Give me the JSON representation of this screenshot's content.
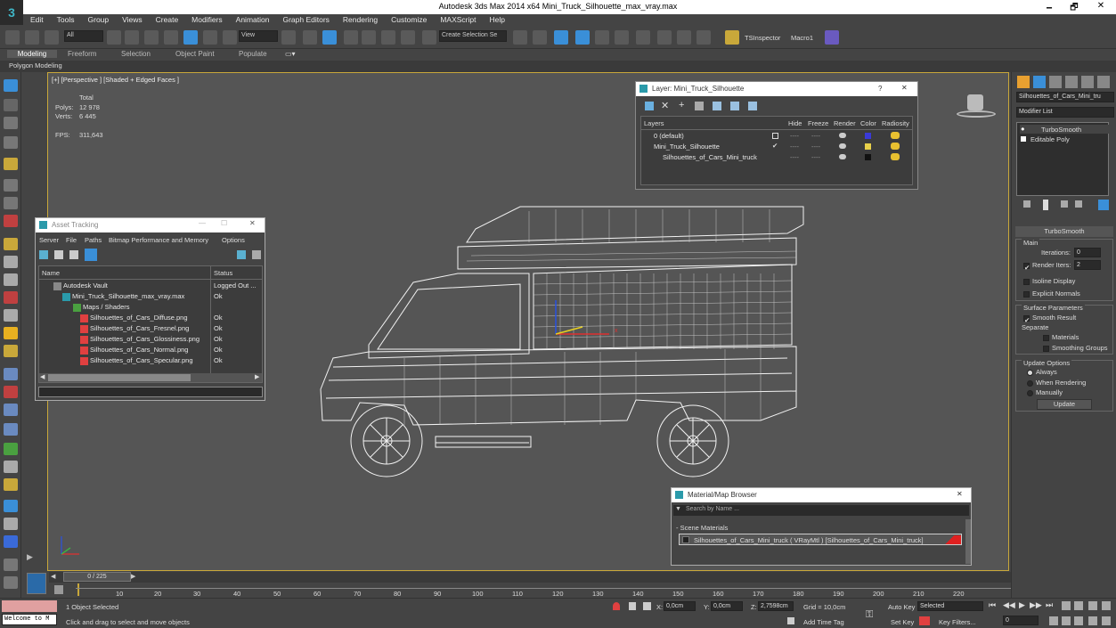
{
  "window": {
    "title": "Autodesk 3ds Max  2014 x64      Mini_Truck_Silhouette_max_vray.max",
    "minimize": "🗕",
    "maximize": "🗗",
    "close": "✕"
  },
  "menu": [
    "Edit",
    "Tools",
    "Group",
    "Views",
    "Create",
    "Modifiers",
    "Animation",
    "Graph Editors",
    "Rendering",
    "Customize",
    "MAXScript",
    "Help"
  ],
  "toolbar": {
    "selection_filter": "All",
    "ref_coord": "View",
    "named_selection_placeholder": "Create Selection Se",
    "tsinspector": "TSInspector",
    "macro": "Macro1"
  },
  "ribbon": {
    "tabs": [
      "Modeling",
      "Freeform",
      "Selection",
      "Object Paint",
      "Populate"
    ],
    "sub": "Polygon Modeling"
  },
  "viewport": {
    "label": "[+] [Perspective ] [Shaded + Edged Faces ]",
    "stats_total": "Total",
    "polys_label": "Polys:",
    "polys_value": "12 978",
    "verts_label": "Verts:",
    "verts_value": "6 445",
    "fps_label": "FPS:",
    "fps_value": "311,643",
    "axis_x": "x"
  },
  "layer_window": {
    "title": "Layer: Mini_Truck_Silhouette",
    "help": "?",
    "close": "✕",
    "columns": [
      "Layers",
      "Hide",
      "Freeze",
      "Render",
      "Color",
      "Radiosity"
    ],
    "rows": [
      {
        "name": "0 (default)",
        "color": "#3a3ad8"
      },
      {
        "name": "Mini_Truck_Silhouette",
        "color": "#e8d04a"
      },
      {
        "name": "Silhouettes_of_Cars_Mini_truck",
        "color": "#111111"
      }
    ]
  },
  "asset_tracking": {
    "title": "Asset Tracking",
    "menu": [
      "Server",
      "File",
      "Paths",
      "Bitmap Performance and Memory",
      "Options"
    ],
    "col_name": "Name",
    "col_status": "Status",
    "rows": [
      {
        "name": "Autodesk Vault",
        "status": "Logged Out ..."
      },
      {
        "name": "Mini_Truck_Silhouette_max_vray.max",
        "status": "Ok"
      },
      {
        "name": "Maps / Shaders",
        "status": ""
      },
      {
        "name": "Silhouettes_of_Cars_Diffuse.png",
        "status": "Ok"
      },
      {
        "name": "Silhouettes_of_Cars_Fresnel.png",
        "status": "Ok"
      },
      {
        "name": "Silhouettes_of_Cars_Glossiness.png",
        "status": "Ok"
      },
      {
        "name": "Silhouettes_of_Cars_Normal.png",
        "status": "Ok"
      },
      {
        "name": "Silhouettes_of_Cars_Specular.png",
        "status": "Ok"
      }
    ]
  },
  "material_browser": {
    "title": "Material/Map Browser",
    "search_placeholder": "Search by Name ...",
    "section": "- Scene Materials",
    "item": "Silhouettes_of_Cars_Mini_truck  ( VRayMtl ) [Silhouettes_of_Cars_Mini_truck]"
  },
  "command_panel": {
    "object_name": "Silhouettes_of_Cars_Mini_tru",
    "modifier_list": "Modifier List",
    "stack": [
      "TurboSmooth",
      "Editable Poly"
    ],
    "rollout_title": "TurboSmooth",
    "main": "Main",
    "iterations_label": "Iterations:",
    "iterations_value": "0",
    "render_iters_label": "Render Iters:",
    "render_iters_value": "2",
    "isoline": "Isoline Display",
    "explicit_normals": "Explicit Normals",
    "surface_params": "Surface Parameters",
    "smooth_result": "Smooth Result",
    "separate": "Separate",
    "materials": "Materials",
    "smoothing_groups": "Smoothing Groups",
    "update_options": "Update Options",
    "always": "Always",
    "when_rendering": "When Rendering",
    "manually": "Manually",
    "update_btn": "Update"
  },
  "timeline": {
    "frame": "0 / 225",
    "ticks": [
      "10",
      "20",
      "30",
      "40",
      "50",
      "60",
      "70",
      "80",
      "90",
      "100",
      "110",
      "120",
      "130",
      "140",
      "150",
      "160",
      "170",
      "180",
      "190",
      "200",
      "210",
      "220"
    ]
  },
  "status": {
    "welcome": "Welcome to M",
    "selected": "1 Object Selected",
    "prompt": "Click and drag to select and move objects",
    "x_label": "X:",
    "x_value": "0,0cm",
    "y_label": "Y:",
    "y_value": "0,0cm",
    "z_label": "Z:",
    "z_value": "2,7598cm",
    "grid": "Grid = 10,0cm",
    "add_time_tag": "Add Time Tag",
    "auto_key": "Auto Key",
    "set_key": "Set Key",
    "key_selected": "Selected",
    "key_filters": "Key Filters...",
    "frame_field": "0"
  }
}
